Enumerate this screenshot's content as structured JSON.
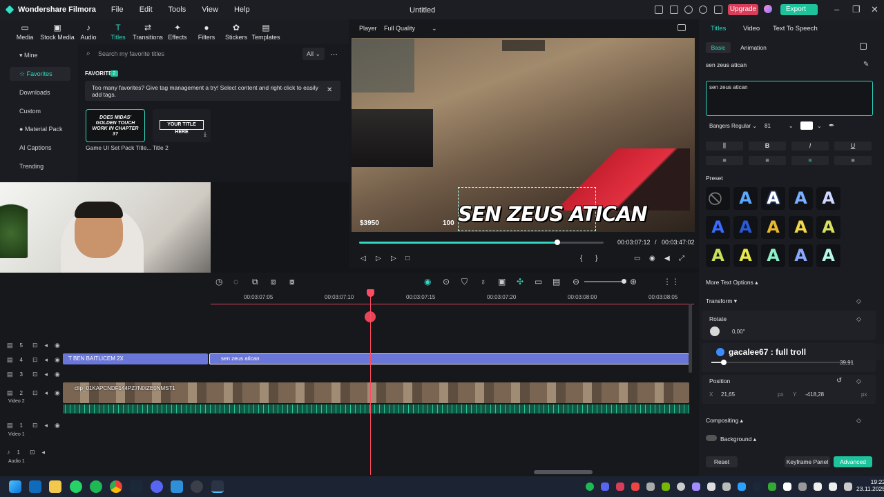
{
  "app": {
    "name": "Wondershare Filmora",
    "document_title": "Untitled",
    "upgrade": "Upgrade",
    "export": "Export"
  },
  "menu": [
    "File",
    "Edit",
    "Tools",
    "View",
    "Help"
  ],
  "media_tools": [
    {
      "label": "Media",
      "icon": "folder-icon"
    },
    {
      "label": "Stock Media",
      "icon": "stock-icon"
    },
    {
      "label": "Audio",
      "icon": "music-icon"
    },
    {
      "label": "Titles",
      "icon": "text-icon"
    },
    {
      "label": "Transitions",
      "icon": "transition-icon"
    },
    {
      "label": "Effects",
      "icon": "sparkle-icon"
    },
    {
      "label": "Filters",
      "icon": "filter-icon"
    },
    {
      "label": "Stickers",
      "icon": "sticker-icon"
    },
    {
      "label": "Templates",
      "icon": "template-icon"
    }
  ],
  "left_nav": [
    "Mine",
    "Favorites",
    "Downloads",
    "Custom",
    "Material Pack",
    "AI Captions",
    "Trending"
  ],
  "assets": {
    "search_placeholder": "Search my favorite titles",
    "filter": "All",
    "favorites_header": "FAVORITES",
    "favorites_count": "2",
    "notice": "Too many favorites? Give tag management a try! Select content and right-click to easily add tags.",
    "items": [
      {
        "caption": "Game UI Set Pack Title...",
        "thumb_text": "DOES MIDAS' GOLDEN TOUCH WORK IN CHAPTER 3?"
      },
      {
        "caption": "Title 2",
        "thumb_text": "YOUR TITLE HERE"
      }
    ]
  },
  "player": {
    "label": "Player",
    "quality": "Full Quality",
    "overlay_text": "SEN ZEUS ATICAN",
    "money": "$3950",
    "hud_num": "100",
    "current_time": "00:03:07:12",
    "separator": "/",
    "total_time": "00:03:47:02",
    "progress": 0.81
  },
  "timeline": {
    "ruler": [
      "00:03:07:05",
      "00:03:07:10",
      "00:03:07:15",
      "00:03:07:20",
      "00:03:08:00",
      "00:03:08:05"
    ],
    "tracks": [
      {
        "num": "5",
        "label": ""
      },
      {
        "num": "4",
        "label": ""
      },
      {
        "num": "3",
        "label": ""
      },
      {
        "num": "2",
        "label": "Video 2"
      },
      {
        "num": "1",
        "label": "Video 1"
      },
      {
        "num": "1",
        "label": "Audio 1"
      }
    ],
    "clip_title_a": "BEN BAITLICEM 2X",
    "clip_title_b": "sen zeus atican",
    "clip_video": "clip_01KAPCNDF144PZ7N0IZE0NMST1"
  },
  "inspector": {
    "tabs": [
      "Titles",
      "Video",
      "Text To Speech"
    ],
    "subtabs": [
      "Basic",
      "Animation"
    ],
    "text_name": "sen zeus atican",
    "text_value": "sen zeus atican",
    "font": "Bangers Regular",
    "size": "81",
    "preset_label": "Preset",
    "more_options": "More Text Options",
    "transform": "Transform",
    "rotate_label": "Rotate",
    "rotate_value": "0,00°",
    "scale_value": "39,91",
    "position_label": "Position",
    "pos_x_label": "X",
    "pos_x": "21,65",
    "pos_y_label": "Y",
    "pos_y": "-418,28",
    "unit": "px",
    "compositing": "Compositing",
    "background": "Background",
    "reset": "Reset",
    "keyframe": "Keyframe Panel",
    "advanced": "Advanced",
    "chat": "gacalee67 : full troll"
  },
  "taskbar": {
    "time": "19:22",
    "date": "23.11.2025"
  }
}
